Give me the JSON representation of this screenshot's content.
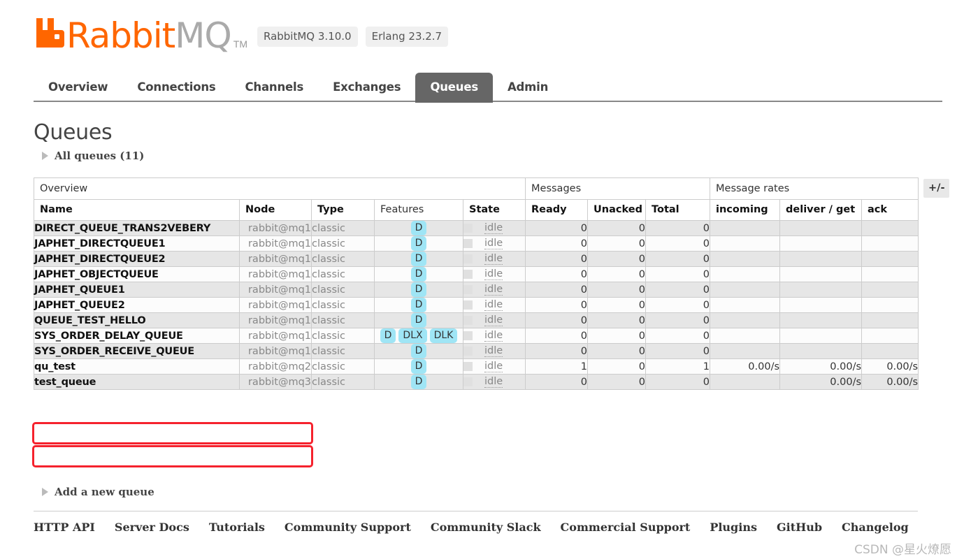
{
  "brand": {
    "logo_rabbit": "Rabbit",
    "logo_mq": "MQ",
    "logo_tm": "TM",
    "logo_mark_icon": "rabbit-logo-icon",
    "accent_color": "#ff6600",
    "version_rabbitmq": "RabbitMQ 3.10.0",
    "version_erlang": "Erlang 23.2.7"
  },
  "nav": {
    "items": [
      {
        "label": "Overview",
        "active": false
      },
      {
        "label": "Connections",
        "active": false
      },
      {
        "label": "Channels",
        "active": false
      },
      {
        "label": "Exchanges",
        "active": false
      },
      {
        "label": "Queues",
        "active": true
      },
      {
        "label": "Admin",
        "active": false
      }
    ]
  },
  "page": {
    "title": "Queues",
    "all_queues_toggler": "All queues (11)",
    "add_queue_toggler": "Add a new queue",
    "plus_minus_button": "+/-"
  },
  "table": {
    "group_headers": [
      {
        "label": "Overview",
        "span": 5
      },
      {
        "label": "Messages",
        "span": 3
      },
      {
        "label": "Message rates",
        "span": 3
      }
    ],
    "columns": [
      {
        "label": "Name",
        "sortable": true
      },
      {
        "label": "Node",
        "sortable": true
      },
      {
        "label": "Type",
        "sortable": true
      },
      {
        "label": "Features",
        "sortable": false
      },
      {
        "label": "State",
        "sortable": true
      },
      {
        "label": "Ready",
        "sortable": true
      },
      {
        "label": "Unacked",
        "sortable": true
      },
      {
        "label": "Total",
        "sortable": true
      },
      {
        "label": "incoming",
        "sortable": true
      },
      {
        "label": "deliver / get",
        "sortable": true
      },
      {
        "label": "ack",
        "sortable": true
      }
    ],
    "rows": [
      {
        "name": "DIRECT_QUEUE_TRANS2VEBERY",
        "node": "rabbit@mq1",
        "type": "classic",
        "features": [
          "D"
        ],
        "state": "idle",
        "ready": "0",
        "unacked": "0",
        "total": "0",
        "incoming": "",
        "deliver_get": "",
        "ack": "",
        "highlighted": false
      },
      {
        "name": "JAPHET_DIRECTQUEUE1",
        "node": "rabbit@mq1",
        "type": "classic",
        "features": [
          "D"
        ],
        "state": "idle",
        "ready": "0",
        "unacked": "0",
        "total": "0",
        "incoming": "",
        "deliver_get": "",
        "ack": "",
        "highlighted": false
      },
      {
        "name": "JAPHET_DIRECTQUEUE2",
        "node": "rabbit@mq1",
        "type": "classic",
        "features": [
          "D"
        ],
        "state": "idle",
        "ready": "0",
        "unacked": "0",
        "total": "0",
        "incoming": "",
        "deliver_get": "",
        "ack": "",
        "highlighted": false
      },
      {
        "name": "JAPHET_OBJECTQUEUE",
        "node": "rabbit@mq1",
        "type": "classic",
        "features": [
          "D"
        ],
        "state": "idle",
        "ready": "0",
        "unacked": "0",
        "total": "0",
        "incoming": "",
        "deliver_get": "",
        "ack": "",
        "highlighted": false
      },
      {
        "name": "JAPHET_QUEUE1",
        "node": "rabbit@mq1",
        "type": "classic",
        "features": [
          "D"
        ],
        "state": "idle",
        "ready": "0",
        "unacked": "0",
        "total": "0",
        "incoming": "",
        "deliver_get": "",
        "ack": "",
        "highlighted": false
      },
      {
        "name": "JAPHET_QUEUE2",
        "node": "rabbit@mq1",
        "type": "classic",
        "features": [
          "D"
        ],
        "state": "idle",
        "ready": "0",
        "unacked": "0",
        "total": "0",
        "incoming": "",
        "deliver_get": "",
        "ack": "",
        "highlighted": false
      },
      {
        "name": "QUEUE_TEST_HELLO",
        "node": "rabbit@mq1",
        "type": "classic",
        "features": [
          "D"
        ],
        "state": "idle",
        "ready": "0",
        "unacked": "0",
        "total": "0",
        "incoming": "",
        "deliver_get": "",
        "ack": "",
        "highlighted": false
      },
      {
        "name": "SYS_ORDER_DELAY_QUEUE",
        "node": "rabbit@mq1",
        "type": "classic",
        "features": [
          "D",
          "DLX",
          "DLK"
        ],
        "state": "idle",
        "ready": "0",
        "unacked": "0",
        "total": "0",
        "incoming": "",
        "deliver_get": "",
        "ack": "",
        "highlighted": false
      },
      {
        "name": "SYS_ORDER_RECEIVE_QUEUE",
        "node": "rabbit@mq1",
        "type": "classic",
        "features": [
          "D"
        ],
        "state": "idle",
        "ready": "0",
        "unacked": "0",
        "total": "0",
        "incoming": "",
        "deliver_get": "",
        "ack": "",
        "highlighted": false
      },
      {
        "name": "qu_test",
        "node": "rabbit@mq2",
        "type": "classic",
        "features": [
          "D"
        ],
        "state": "idle",
        "ready": "1",
        "unacked": "0",
        "total": "1",
        "incoming": "0.00/s",
        "deliver_get": "0.00/s",
        "ack": "0.00/s",
        "highlighted": true
      },
      {
        "name": "test_queue",
        "node": "rabbit@mq3",
        "type": "classic",
        "features": [
          "D"
        ],
        "state": "idle",
        "ready": "0",
        "unacked": "0",
        "total": "0",
        "incoming": "",
        "deliver_get": "0.00/s",
        "ack": "0.00/s",
        "highlighted": true
      }
    ]
  },
  "footer": {
    "links": [
      "HTTP API",
      "Server Docs",
      "Tutorials",
      "Community Support",
      "Community Slack",
      "Commercial Support",
      "Plugins",
      "GitHub",
      "Changelog"
    ]
  },
  "watermark": {
    "text": "CSDN @星火燎愿"
  }
}
